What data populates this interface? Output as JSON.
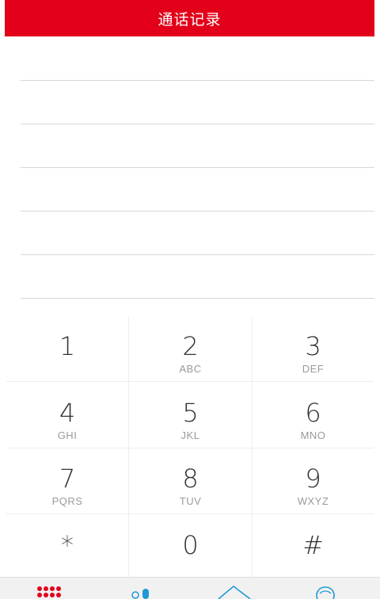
{
  "header": {
    "title": "通话记录"
  },
  "colors": {
    "accent": "#e2001a",
    "tab_icon_blue": "#1e9ad6"
  },
  "keypad": {
    "keys": [
      {
        "digit": "1",
        "letters": ""
      },
      {
        "digit": "2",
        "letters": "ABC"
      },
      {
        "digit": "3",
        "letters": "DEF"
      },
      {
        "digit": "4",
        "letters": "GHI"
      },
      {
        "digit": "5",
        "letters": "JKL"
      },
      {
        "digit": "6",
        "letters": "MNO"
      },
      {
        "digit": "7",
        "letters": "PQRS"
      },
      {
        "digit": "8",
        "letters": "TUV"
      },
      {
        "digit": "9",
        "letters": "WXYZ"
      },
      {
        "digit": "*",
        "letters": ""
      },
      {
        "digit": "0",
        "letters": ""
      },
      {
        "digit": "#",
        "letters": ""
      }
    ]
  },
  "bottom_nav": {
    "items": [
      {
        "icon": "dialpad-icon"
      },
      {
        "icon": "contacts-icon"
      },
      {
        "icon": "home-icon"
      },
      {
        "icon": "profile-icon"
      }
    ]
  }
}
